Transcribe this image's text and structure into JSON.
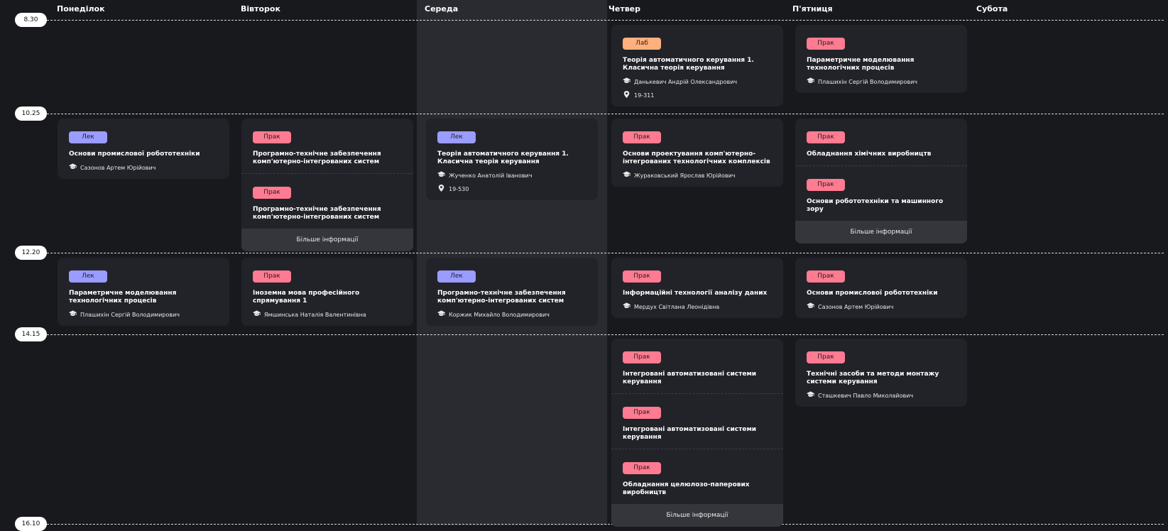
{
  "days": [
    "Понеділок",
    "Вівторок",
    "Середа",
    "Четвер",
    "П'ятниця",
    "Субота"
  ],
  "times": [
    "8.30",
    "10.25",
    "12.20",
    "14.15",
    "16.10"
  ],
  "more_label": "Більше інформації",
  "colors": {
    "lek": "#9b9cff",
    "prak": "#ff7b91",
    "lab": "#ffb07c",
    "background": "#18191d",
    "card": "#222329"
  },
  "slots": {
    "slot1_thu": [
      {
        "type": "Лаб",
        "subject": "Теорія автоматичного керування 1. Класична теорія керування",
        "teacher": "Данькевич Андрій Олександрович",
        "room": "19-311"
      }
    ],
    "slot1_fri": [
      {
        "type": "Прак",
        "subject": "Параметричне моделювання технологічних процесів",
        "teacher": "Плашихін Сергій Володимирович"
      }
    ],
    "slot2_mon": [
      {
        "type": "Лек",
        "subject": "Основи промислової робототехніки",
        "teacher": "Сазонов Артем Юрійович"
      }
    ],
    "slot2_tue": [
      {
        "type": "Прак",
        "subject": "Програмно-технічне забезпечення комп'ютерно-інтегрованих систем"
      },
      {
        "type": "Прак",
        "subject": "Програмно-технічне забезпечення комп'ютерно-інтегрованих систем"
      }
    ],
    "slot2_wed": [
      {
        "type": "Лек",
        "subject": "Теорія автоматичного керування 1. Класична теорія керування",
        "teacher": "Жученко Анатолій Іванович",
        "room": "19-530"
      }
    ],
    "slot2_thu": [
      {
        "type": "Прак",
        "subject": "Основи проектування комп'ютерно-інтегрованих технологічних комплексів",
        "teacher": "Жураковський Ярослав Юрійович"
      }
    ],
    "slot2_fri": [
      {
        "type": "Прак",
        "subject": "Обладнання хімічних виробництв"
      },
      {
        "type": "Прак",
        "subject": "Основи робототехніки та машинного зору"
      }
    ],
    "slot3_mon": [
      {
        "type": "Лек",
        "subject": "Параметричне моделювання технологічних процесів",
        "teacher": "Плашихін Сергій Володимирович"
      }
    ],
    "slot3_tue": [
      {
        "type": "Прак",
        "subject": "Іноземна мова професійного спрямування 1",
        "teacher": "Ямшинська Наталія Валентинівна"
      }
    ],
    "slot3_wed": [
      {
        "type": "Лек",
        "subject": "Програмно-технічне забезпечення комп'ютерно-інтегрованих систем",
        "teacher": "Коржик Михайло Володимирович"
      }
    ],
    "slot3_thu": [
      {
        "type": "Прак",
        "subject": "Інформаційні технології аналізу даних",
        "teacher": "Мердух Світлана Леонідівна"
      }
    ],
    "slot3_fri": [
      {
        "type": "Прак",
        "subject": "Основи промислової робототехніки",
        "teacher": "Сазонов Артем Юрійович"
      }
    ],
    "slot4_thu": [
      {
        "type": "Прак",
        "subject": "Інтегровані автоматизовані системи керування"
      },
      {
        "type": "Прак",
        "subject": "Інтегровані автоматизовані системи керування"
      },
      {
        "type": "Прак",
        "subject": "Обладнання целюлозо-паперових виробництв"
      }
    ],
    "slot4_fri": [
      {
        "type": "Прак",
        "subject": "Технічні засоби та методи монтажу системи керування",
        "teacher": "Сташкевич Павло Миколайович"
      }
    ]
  }
}
